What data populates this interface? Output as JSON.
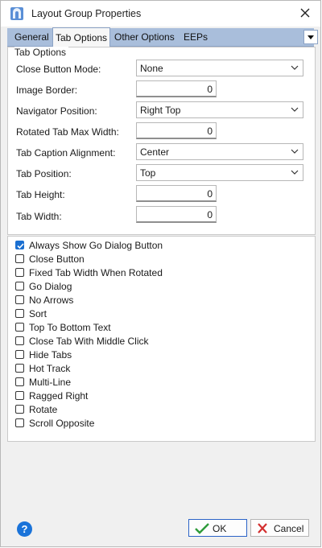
{
  "window": {
    "title": "Layout Group Properties",
    "app_icon": "layout-group-icon",
    "close_icon": "close-icon"
  },
  "tabs": [
    {
      "label": "General",
      "active": false
    },
    {
      "label": "Tab Options",
      "active": true
    },
    {
      "label": "Other Options",
      "active": false
    },
    {
      "label": "EEPs",
      "active": false
    }
  ],
  "tab_options": {
    "group_label": "Tab Options",
    "fields": [
      {
        "label": "Close Button Mode:",
        "type": "combo",
        "value": "None"
      },
      {
        "label": "Image Border:",
        "type": "number",
        "value": "0"
      },
      {
        "label": "Navigator Position:",
        "type": "combo",
        "value": "Right Top"
      },
      {
        "label": "Rotated Tab Max Width:",
        "type": "number",
        "value": "0"
      },
      {
        "label": "Tab Caption Alignment:",
        "type": "combo",
        "value": "Center"
      },
      {
        "label": "Tab Position:",
        "type": "combo",
        "value": "Top"
      },
      {
        "label": "Tab Height:",
        "type": "number",
        "value": "0"
      },
      {
        "label": "Tab Width:",
        "type": "number",
        "value": "0"
      }
    ]
  },
  "checkboxes": [
    {
      "label": "Always Show Go Dialog Button",
      "checked": true
    },
    {
      "label": "Close Button",
      "checked": false
    },
    {
      "label": "Fixed Tab Width When Rotated",
      "checked": false
    },
    {
      "label": "Go Dialog",
      "checked": false
    },
    {
      "label": "No Arrows",
      "checked": false
    },
    {
      "label": "Sort",
      "checked": false
    },
    {
      "label": "Top To Bottom Text",
      "checked": false
    },
    {
      "label": "Close Tab With Middle Click",
      "checked": false
    },
    {
      "label": "Hide Tabs",
      "checked": false
    },
    {
      "label": "Hot Track",
      "checked": false
    },
    {
      "label": "Multi-Line",
      "checked": false
    },
    {
      "label": "Ragged Right",
      "checked": false
    },
    {
      "label": "Rotate",
      "checked": false
    },
    {
      "label": "Scroll Opposite",
      "checked": false
    }
  ],
  "footer": {
    "help_glyph": "?",
    "ok_label": "OK",
    "cancel_label": "Cancel"
  },
  "colors": {
    "tabbar": "#a9bedb",
    "accent": "#1a6fd1",
    "ok_check": "#2e9b3a",
    "cancel_x": "#d32f2f"
  }
}
